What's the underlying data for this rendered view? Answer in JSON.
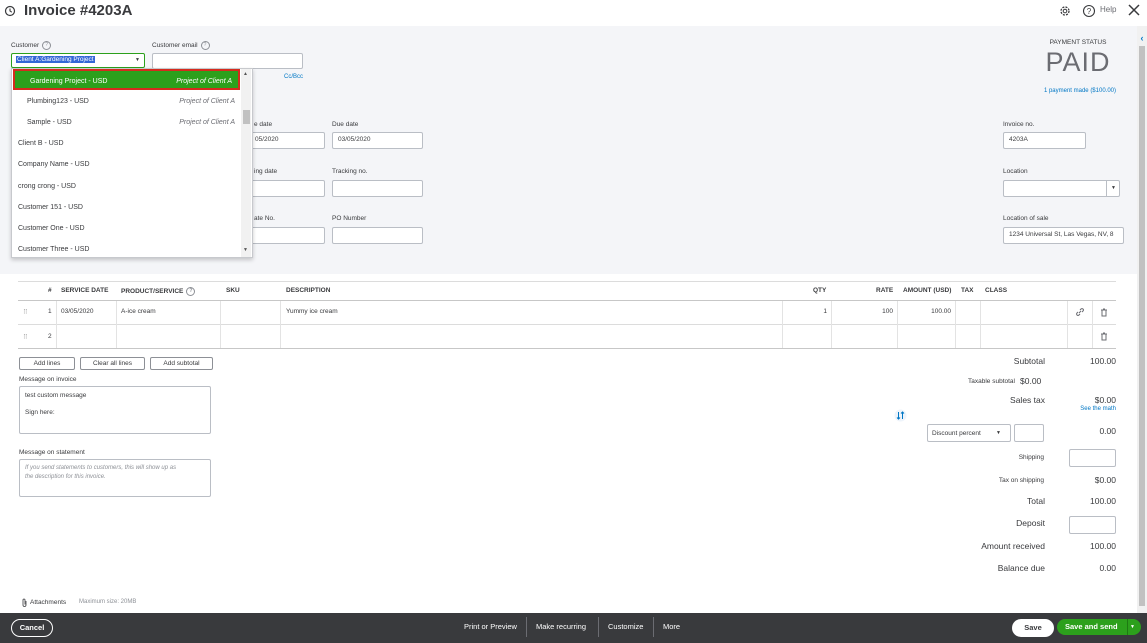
{
  "header": {
    "title": "Invoice #4203A",
    "help_label": "Help"
  },
  "customer": {
    "label": "Customer",
    "value": "Client A:Gardening Project",
    "email_label": "Customer email",
    "email_value": "",
    "cc_bcc": "Cc/Bcc"
  },
  "dropdown": {
    "items": [
      {
        "name": "Gardening Project - USD",
        "sub": "Project of Client A"
      },
      {
        "name": "Plumbing123 - USD",
        "sub": "Project of Client A"
      },
      {
        "name": "Sample - USD",
        "sub": "Project of Client A"
      },
      {
        "name": "Client B - USD",
        "sub": ""
      },
      {
        "name": "Company Name - USD",
        "sub": ""
      },
      {
        "name": "crong crong - USD",
        "sub": ""
      },
      {
        "name": "Customer 151 - USD",
        "sub": ""
      },
      {
        "name": "Customer One - USD",
        "sub": ""
      },
      {
        "name": "Customer Three - USD",
        "sub": ""
      }
    ]
  },
  "payment": {
    "status_label": "PAYMENT STATUS",
    "status": "PAID",
    "link": "1 payment made ($100.00)"
  },
  "fields": {
    "invoice_date_label": "e date",
    "invoice_date_value": "05/2020",
    "due_date_label": "Due date",
    "due_date_value": "03/05/2020",
    "invoice_no_label": "Invoice no.",
    "invoice_no_value": "4203A",
    "ship_date_label": "ing date",
    "tracking_label": "Tracking no.",
    "location_label": "Location",
    "estimate_label": "ate No.",
    "po_label": "PO Number",
    "location_sale_label": "Location of sale",
    "location_sale_value": "1234 Universal St, Las Vegas, NV, 8"
  },
  "table": {
    "headers": [
      "#",
      "SERVICE DATE",
      "PRODUCT/SERVICE",
      "SKU",
      "DESCRIPTION",
      "QTY",
      "RATE",
      "AMOUNT (USD)",
      "TAX",
      "CLASS"
    ],
    "rows": [
      {
        "num": "1",
        "date": "03/05/2020",
        "product": "A-ice cream",
        "sku": "",
        "desc": "Yummy ice cream",
        "qty": "1",
        "rate": "100",
        "amount": "100.00"
      },
      {
        "num": "2",
        "date": "",
        "product": "",
        "sku": "",
        "desc": "",
        "qty": "",
        "rate": "",
        "amount": ""
      }
    ]
  },
  "buttons": {
    "add_lines": "Add lines",
    "clear_lines": "Clear all lines",
    "add_subtotal": "Add subtotal"
  },
  "messages": {
    "invoice_label": "Message on invoice",
    "invoice_line1": "test custom message",
    "invoice_line2": "Sign here:",
    "statement_label": "Message on statement",
    "statement_placeholder_1": "If you send statements to customers, this will show up as",
    "statement_placeholder_2": "the description for this invoice."
  },
  "totals": {
    "subtotal_label": "Subtotal",
    "subtotal_value": "100.00",
    "taxable_label": "Taxable subtotal",
    "taxable_value": "$0.00",
    "sales_tax_label": "Sales tax",
    "sales_tax_value": "$0.00",
    "see_math": "See the math",
    "discount_select": "Discount percent",
    "discount_value": "0.00",
    "shipping_label": "Shipping",
    "tax_shipping_label": "Tax on shipping",
    "tax_shipping_value": "$0.00",
    "total_label": "Total",
    "total_value": "100.00",
    "deposit_label": "Deposit",
    "received_label": "Amount received",
    "received_value": "100.00",
    "balance_label": "Balance due",
    "balance_value": "0.00"
  },
  "attachments": {
    "label": "Attachments",
    "max": "Maximum size: 20MB"
  },
  "footer": {
    "cancel": "Cancel",
    "print": "Print or Preview",
    "recurring": "Make recurring",
    "customize": "Customize",
    "more": "More",
    "save": "Save",
    "save_send": "Save and send"
  },
  "colors": {
    "accent": "#2ca01c",
    "link": "#0077c5",
    "footer_bg": "#393a3d",
    "highlight_border": "#d52b1e"
  }
}
